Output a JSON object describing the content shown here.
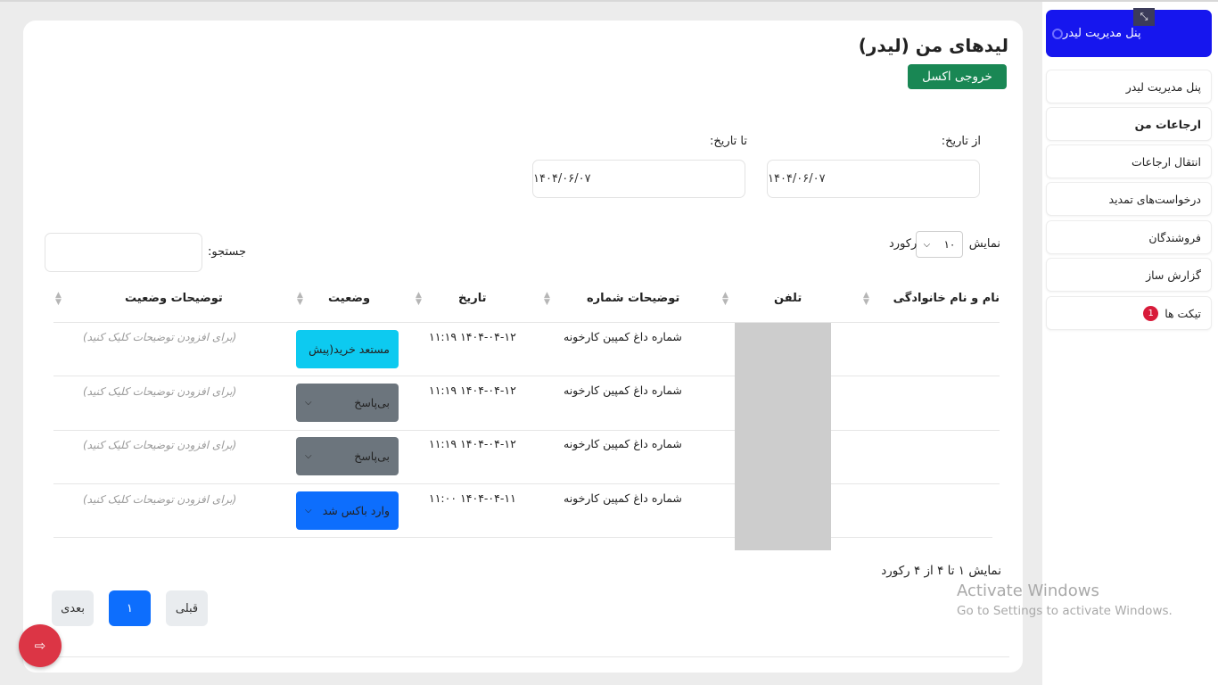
{
  "sidebar": {
    "panel_title": "پنل مدیریت لیدر",
    "items": [
      {
        "label": "پنل مدیریت لیدر"
      },
      {
        "label": "ارجاعات من"
      },
      {
        "label": "انتقال ارجاعات"
      },
      {
        "label": "درخواست‌های تمدید"
      },
      {
        "label": "فروشندگان"
      },
      {
        "label": "گزارش ساز"
      },
      {
        "label": "تیکت ها",
        "badge": "1"
      }
    ]
  },
  "main": {
    "title": "لیدهای من (لیدر)",
    "excel_button": "خروجی اکسل",
    "from_date": {
      "label": "از تاریخ:",
      "value": "۱۴۰۴/۰۶/۰۷"
    },
    "to_date": {
      "label": "تا تاریخ:",
      "value": "۱۴۰۴/۰۶/۰۷"
    },
    "length": {
      "show": "نمایش",
      "value": "۱۰",
      "records": "رکورد"
    },
    "search_label": "جستجو:",
    "columns": [
      "نام و نام خانوادگی",
      "تلفن",
      "توضیحات شماره",
      "تاریخ",
      "وضعیت",
      "توضیحات وضعیت"
    ],
    "rows": [
      {
        "desc": "شماره داغ کمپین کارخونه",
        "date": "۱۴۰۴-۰۴-۱۲ ۱۱:۱۹",
        "status": "مستعد خرید(پیش",
        "note": "(برای افزودن توضیحات کلیک کنید)"
      },
      {
        "desc": "شماره داغ کمپین کارخونه",
        "date": "۱۴۰۴-۰۴-۱۲ ۱۱:۱۹",
        "status": "بی‌پاسخ",
        "note": "(برای افزودن توضیحات کلیک کنید)"
      },
      {
        "desc": "شماره داغ کمپین کارخونه",
        "date": "۱۴۰۴-۰۴-۱۲ ۱۱:۱۹",
        "status": "بی‌پاسخ",
        "note": "(برای افزودن توضیحات کلیک کنید)"
      },
      {
        "desc": "شماره داغ کمپین کارخونه",
        "date": "۱۴۰۴-۰۴-۱۱ ۱۱:۰۰",
        "status": "وارد باکس شد",
        "note": "(برای افزودن توضیحات کلیک کنید)"
      }
    ],
    "info": "نمایش ۱ تا ۴ از ۴ رکورد",
    "pagination": {
      "prev": "قبلی",
      "page": "۱",
      "next": "بعدی"
    }
  },
  "watermark": {
    "line1": "Activate Windows",
    "line2": "Go to Settings to activate Windows."
  },
  "colors": {
    "accent": "#1616ee",
    "excel": "#198754",
    "status_ready": "#0dcaf0",
    "status_noanswer": "#6c757d",
    "status_box": "#0d6efd",
    "logout": "#dc3545"
  }
}
